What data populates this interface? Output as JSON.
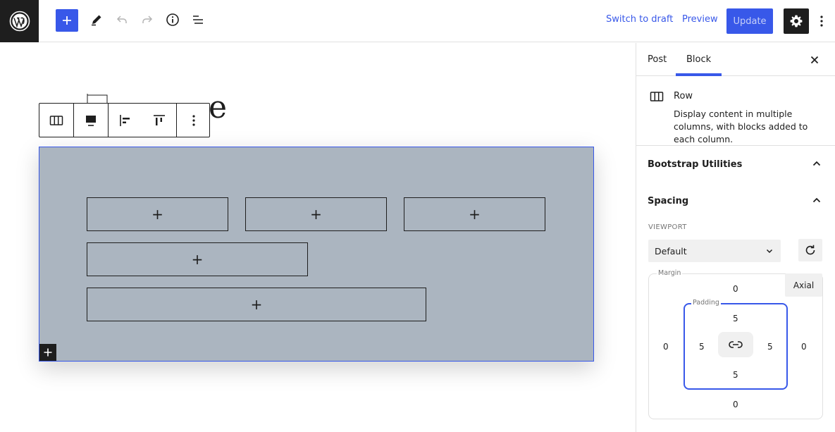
{
  "topbar": {
    "logo_icon": "wordpress-logo-icon",
    "switch_to_draft_label": "Switch to draft",
    "preview_label": "Preview",
    "update_label": "Update",
    "accent_color": "#3858e9"
  },
  "canvas": {
    "title_partial": "e",
    "row_background": "#abb5c0",
    "columns": [
      {
        "label": "+"
      },
      {
        "label": "+"
      },
      {
        "label": "+"
      },
      {
        "label": "+"
      },
      {
        "label": "+"
      }
    ]
  },
  "sidebar": {
    "tabs": [
      {
        "label": "Post",
        "active": false
      },
      {
        "label": "Block",
        "active": true
      }
    ],
    "block": {
      "name": "Row",
      "description": "Display content in multiple columns, with blocks added to each column."
    },
    "panels": {
      "bootstrap_utilities": "Bootstrap Utilities",
      "spacing": "Spacing"
    },
    "viewport_label": "VIEWPORT",
    "viewport_value": "Default",
    "margin_label": "Margin",
    "padding_label": "Padding",
    "axial_label": "Axial",
    "margin": {
      "top": "0",
      "right": "0",
      "bottom": "0",
      "left": "0"
    },
    "padding": {
      "top": "5",
      "right": "5",
      "bottom": "5",
      "left": "5"
    }
  }
}
